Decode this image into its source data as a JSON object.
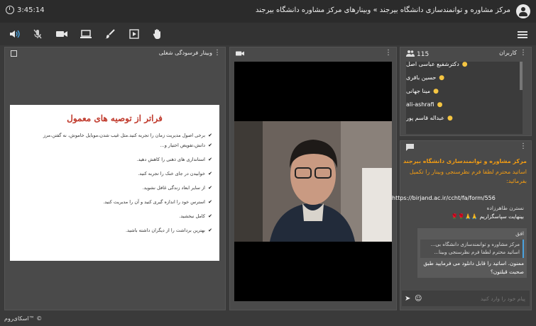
{
  "topbar": {
    "clock": "3:45:14",
    "title": "مرکز مشاوره و توانمندسازی دانشگاه بیرجند » وبینارهای مرکز مشاوره دانشگاه بیرجند"
  },
  "toolbar": {
    "icons": [
      "speaker-icon",
      "mic-muted-icon",
      "camera-icon",
      "screen-share-icon",
      "brush-icon",
      "media-icon",
      "hand-icon",
      "menu-icon"
    ]
  },
  "presentation": {
    "header": "وبینار فرسودگی شغلی",
    "slide_title": "فراتر از توصیه های معمول",
    "bullets": [
      "برخی اصول مدیریت زمان را تجربه کنید.مثل غیب شدن،موبایل خاموش، نه گفتن،مرز",
      "دانش،تفویض اختیار و...",
      "استانداری های ذهنی را کاهش دهید.",
      "خوابیدن در جای خنک را تجربه کنید.",
      "از سایر ابعاد زندگی غافل نشوید.",
      "استرس خود را اندازه گیری کنید و آن را مدیریت کنید.",
      "کامل نبخشید.",
      "بهترین برداشت را از دیگران داشته باشید."
    ]
  },
  "users": {
    "header": "کاربران",
    "count": "115",
    "list": [
      "دکترشفیع عباسی اصل",
      "حسین باقری",
      "مینا جهانی",
      "ali-ashrafi",
      "عبداله قاسم پور"
    ]
  },
  "chat": {
    "announce_title": "مرکز مشاوره و توانمندسازی دانشگاه بیرجند",
    "announce_body": "اساتید محترم لطفا فرم نظرسنجی وبینار را تکمیل",
    "announce_link_label": "بفرمائید:",
    "announce_link": "https://birjand.ac.ir/ccht/fa/form/556",
    "msg1_name": "نسترن طاهرزاده",
    "msg1_text": "بینهایت سپاسگزاریم 🙏🙏🌹🌹",
    "msg2_name": "افق",
    "quote1": "مرکز مشاوره و توانمندسازی دانشگاه بی...",
    "quote2": "اساتید محترم لطفا فرم نظرسنجی وبینا...",
    "msg2_text": "ممنون. اساتید را قابل دانلود می فرمایید طبق صحبت قبلتون؟",
    "input_placeholder": "پیام خود را وارد کنید"
  },
  "footer": {
    "brand": "اسکای‌روم™ ©"
  }
}
